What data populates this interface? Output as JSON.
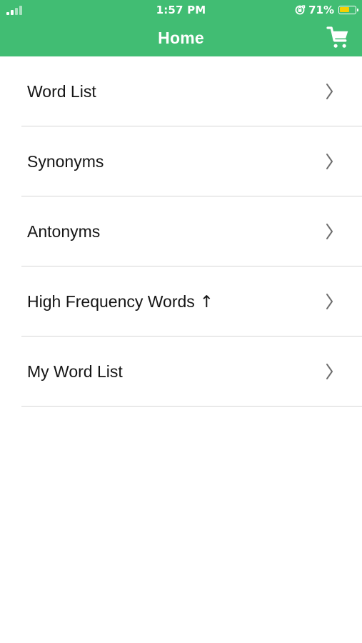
{
  "status_bar": {
    "time": "1:57 PM",
    "battery_percent": "71%",
    "battery_level": 0.71,
    "signal_icon": "cellular-signal-icon",
    "orientation_icon": "orientation-lock-icon",
    "battery_icon": "battery-icon"
  },
  "header": {
    "title": "Home",
    "cart_icon": "shopping-cart-icon",
    "background_color": "#41bd73"
  },
  "menu": {
    "items": [
      {
        "label": "Word List",
        "arrow": "",
        "chevron_icon": "chevron-right-icon"
      },
      {
        "label": "Synonyms",
        "arrow": "",
        "chevron_icon": "chevron-right-icon"
      },
      {
        "label": "Antonyms",
        "arrow": "",
        "chevron_icon": "chevron-right-icon"
      },
      {
        "label": "High Frequency Words",
        "arrow": "↑",
        "chevron_icon": "chevron-right-icon"
      },
      {
        "label": "My Word List",
        "arrow": "",
        "chevron_icon": "chevron-right-icon"
      }
    ]
  }
}
